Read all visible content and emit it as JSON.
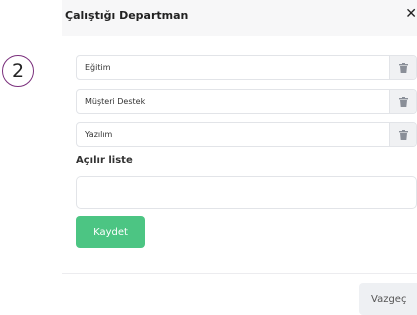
{
  "step_badge": "2",
  "modal": {
    "title": "Çalıştığı Departman",
    "close_glyph": "✕"
  },
  "departments": [
    {
      "value": "Eğitim",
      "delete_icon": "trash-icon"
    },
    {
      "value": "Müşteri Destek",
      "delete_icon": "trash-icon"
    },
    {
      "value": "Yazılım",
      "delete_icon": "trash-icon"
    }
  ],
  "dropdown": {
    "label": "Açılır liste",
    "value": ""
  },
  "actions": {
    "save_label": "Kaydet",
    "cancel_label": "Vazgeç"
  },
  "colors": {
    "save_button": "#4cc583",
    "badge_border": "#7a2f7c",
    "header_bg": "#f7f7f8"
  }
}
